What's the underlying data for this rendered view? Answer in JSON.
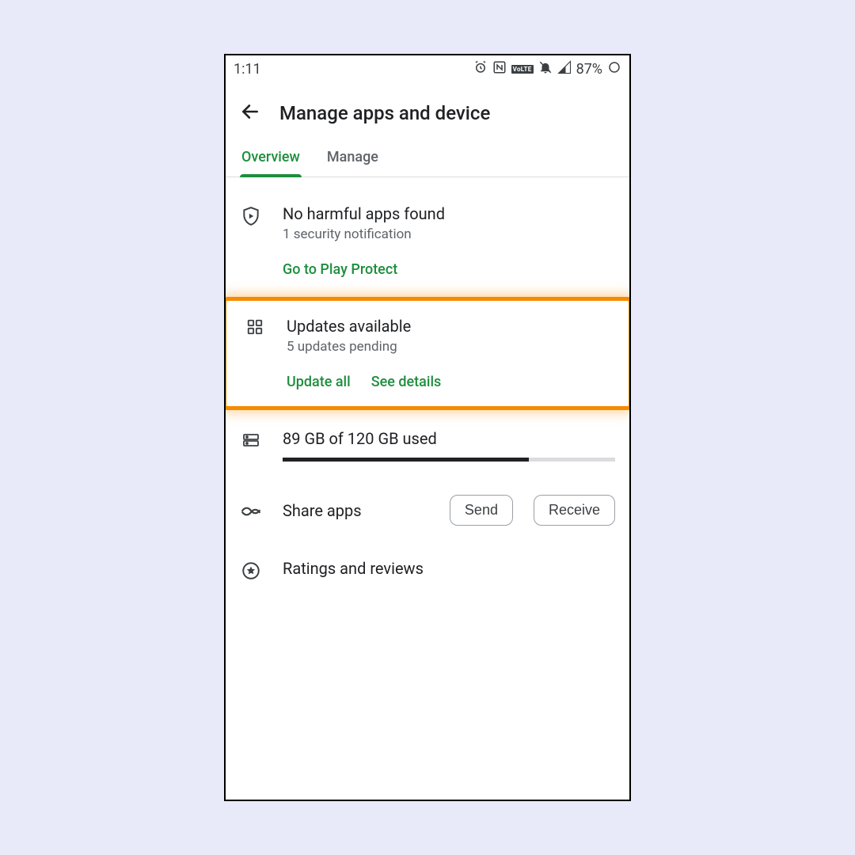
{
  "status": {
    "time": "1:11",
    "battery": "87%"
  },
  "header": {
    "title": "Manage apps and device"
  },
  "tabs": {
    "overview": "Overview",
    "manage": "Manage"
  },
  "protect": {
    "title": "No harmful apps found",
    "subtitle": "1 security notification",
    "link": "Go to Play Protect"
  },
  "updates": {
    "title": "Updates available",
    "subtitle": "5 updates pending",
    "update_all": "Update all",
    "see_details": "See details"
  },
  "storage": {
    "label": "89 GB of 120 GB used",
    "used": 89,
    "total": 120
  },
  "share": {
    "title": "Share apps",
    "send": "Send",
    "receive": "Receive"
  },
  "ratings": {
    "title": "Ratings and reviews"
  },
  "colors": {
    "accent": "#1e8e3e",
    "highlight": "#f58b00"
  }
}
